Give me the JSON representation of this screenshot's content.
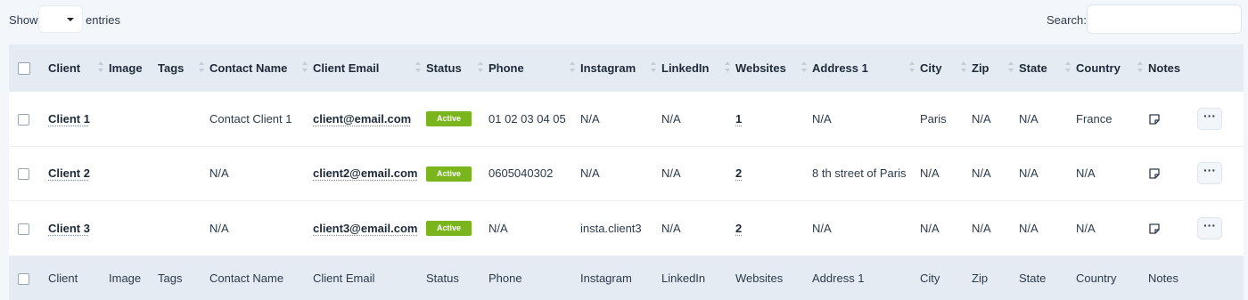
{
  "controls": {
    "show_label": "Show",
    "entries_label": "entries",
    "entries_value": "",
    "search_label": "Search:",
    "search_value": ""
  },
  "columns": [
    "Client",
    "Image",
    "Tags",
    "Contact Name",
    "Client Email",
    "Status",
    "Phone",
    "Instagram",
    "LinkedIn",
    "Websites",
    "Address 1",
    "City",
    "Zip",
    "State",
    "Country",
    "Notes"
  ],
  "rows": [
    {
      "client": "Client 1",
      "image": "",
      "tags": "",
      "contact": "Contact Client 1",
      "email": "client@email.com",
      "status": "Active",
      "phone": "01 02 03 04 05",
      "instagram": "N/A",
      "linkedin": "N/A",
      "websites": "1",
      "address": "N/A",
      "city": "Paris",
      "zip": "N/A",
      "state": "N/A",
      "country": "France"
    },
    {
      "client": "Client 2",
      "image": "",
      "tags": "",
      "contact": "N/A",
      "email": "client2@email.com",
      "status": "Active",
      "phone": "0605040302",
      "instagram": "N/A",
      "linkedin": "N/A",
      "websites": "2",
      "address": "8 th street of Paris",
      "city": "N/A",
      "zip": "N/A",
      "state": "N/A",
      "country": "N/A"
    },
    {
      "client": "Client 3",
      "image": "",
      "tags": "",
      "contact": "N/A",
      "email": "client3@email.com",
      "status": "Active",
      "phone": "N/A",
      "instagram": "insta.client3",
      "linkedin": "N/A",
      "websites": "2",
      "address": "N/A",
      "city": "N/A",
      "zip": "N/A",
      "state": "N/A",
      "country": "N/A"
    }
  ],
  "actions": {
    "more_label": "···"
  },
  "icons": {
    "notes": "note-icon",
    "more": "ellipsis-icon",
    "sort": "sort-icon",
    "dropdown": "caret-down-icon"
  },
  "colors": {
    "status_active": "#7ab51d",
    "header_bg": "#e5ebf3",
    "page_bg": "#f3f6fa"
  }
}
